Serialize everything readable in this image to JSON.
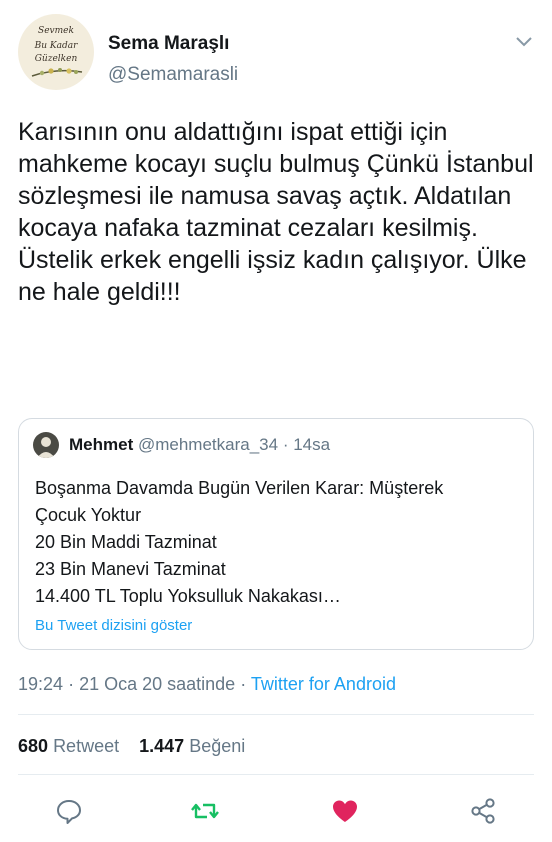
{
  "user": {
    "name": "Sema Maraşlı",
    "handle": "@Semamarasli",
    "avatar_lines": [
      "Sevmek",
      "Bu Kadar",
      "Güzelken"
    ]
  },
  "tweet": {
    "text": "Karısının onu aldattığını ispat ettiği için mahkeme kocayı suçlu bulmuş Çünkü İstanbul sözleşmesi ile namusa savaş açtık. Aldatılan kocaya nafaka tazminat cezaları kesilmiş. Üstelik erkek engelli işsiz kadın çalışıyor. Ülke ne hale geldi!!!"
  },
  "quote": {
    "name": "Mehmet",
    "handle": "@mehmetkara_34",
    "separator": "·",
    "time": "14sa",
    "lines": [
      "Boşanma Davamda Bugün Verilen Karar: Müşterek",
      "Çocuk Yoktur",
      "20 Bin Maddi Tazminat",
      "23 Bin Manevi Tazminat",
      "14.400 TL Toplu Yoksulluk Nakakası…"
    ],
    "thread_link": "Bu Tweet dizisini göster"
  },
  "meta": {
    "time": "19:24",
    "date": "21 Oca 20 saatinde",
    "separator": "·",
    "source": "Twitter for Android"
  },
  "stats": {
    "retweets": "680",
    "retweets_label": "Retweet",
    "likes": "1.447",
    "likes_label": "Beğeni"
  },
  "colors": {
    "accent": "#1da1f2",
    "retweet": "#17bf63",
    "like": "#e0245e",
    "muted": "#657786",
    "text": "#14171a"
  },
  "icons": {
    "reply": "reply-icon",
    "retweet": "retweet-icon",
    "like": "heart-icon",
    "share": "share-icon",
    "menu": "chevron-down-icon"
  }
}
